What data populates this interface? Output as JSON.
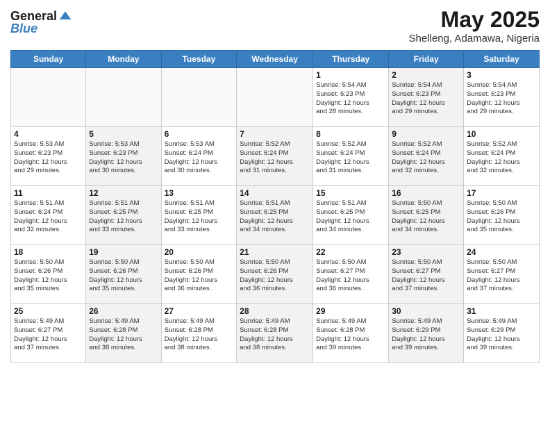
{
  "logo": {
    "line1": "General",
    "line2": "Blue"
  },
  "title": "May 2025",
  "subtitle": "Shelleng, Adamawa, Nigeria",
  "weekdays": [
    "Sunday",
    "Monday",
    "Tuesday",
    "Wednesday",
    "Thursday",
    "Friday",
    "Saturday"
  ],
  "weeks": [
    [
      {
        "day": "",
        "empty": true
      },
      {
        "day": "",
        "empty": true
      },
      {
        "day": "",
        "empty": true
      },
      {
        "day": "",
        "empty": true
      },
      {
        "day": "1",
        "gray": false,
        "lines": [
          "Sunrise: 5:54 AM",
          "Sunset: 6:23 PM",
          "Daylight: 12 hours",
          "and 28 minutes."
        ]
      },
      {
        "day": "2",
        "gray": true,
        "lines": [
          "Sunrise: 5:54 AM",
          "Sunset: 6:23 PM",
          "Daylight: 12 hours",
          "and 29 minutes."
        ]
      },
      {
        "day": "3",
        "gray": false,
        "lines": [
          "Sunrise: 5:54 AM",
          "Sunset: 6:23 PM",
          "Daylight: 12 hours",
          "and 29 minutes."
        ]
      }
    ],
    [
      {
        "day": "4",
        "gray": false,
        "lines": [
          "Sunrise: 5:53 AM",
          "Sunset: 6:23 PM",
          "Daylight: 12 hours",
          "and 29 minutes."
        ]
      },
      {
        "day": "5",
        "gray": true,
        "lines": [
          "Sunrise: 5:53 AM",
          "Sunset: 6:23 PM",
          "Daylight: 12 hours",
          "and 30 minutes."
        ]
      },
      {
        "day": "6",
        "gray": false,
        "lines": [
          "Sunrise: 5:53 AM",
          "Sunset: 6:24 PM",
          "Daylight: 12 hours",
          "and 30 minutes."
        ]
      },
      {
        "day": "7",
        "gray": true,
        "lines": [
          "Sunrise: 5:52 AM",
          "Sunset: 6:24 PM",
          "Daylight: 12 hours",
          "and 31 minutes."
        ]
      },
      {
        "day": "8",
        "gray": false,
        "lines": [
          "Sunrise: 5:52 AM",
          "Sunset: 6:24 PM",
          "Daylight: 12 hours",
          "and 31 minutes."
        ]
      },
      {
        "day": "9",
        "gray": true,
        "lines": [
          "Sunrise: 5:52 AM",
          "Sunset: 6:24 PM",
          "Daylight: 12 hours",
          "and 32 minutes."
        ]
      },
      {
        "day": "10",
        "gray": false,
        "lines": [
          "Sunrise: 5:52 AM",
          "Sunset: 6:24 PM",
          "Daylight: 12 hours",
          "and 32 minutes."
        ]
      }
    ],
    [
      {
        "day": "11",
        "gray": false,
        "lines": [
          "Sunrise: 5:51 AM",
          "Sunset: 6:24 PM",
          "Daylight: 12 hours",
          "and 32 minutes."
        ]
      },
      {
        "day": "12",
        "gray": true,
        "lines": [
          "Sunrise: 5:51 AM",
          "Sunset: 6:25 PM",
          "Daylight: 12 hours",
          "and 33 minutes."
        ]
      },
      {
        "day": "13",
        "gray": false,
        "lines": [
          "Sunrise: 5:51 AM",
          "Sunset: 6:25 PM",
          "Daylight: 12 hours",
          "and 33 minutes."
        ]
      },
      {
        "day": "14",
        "gray": true,
        "lines": [
          "Sunrise: 5:51 AM",
          "Sunset: 6:25 PM",
          "Daylight: 12 hours",
          "and 34 minutes."
        ]
      },
      {
        "day": "15",
        "gray": false,
        "lines": [
          "Sunrise: 5:51 AM",
          "Sunset: 6:25 PM",
          "Daylight: 12 hours",
          "and 34 minutes."
        ]
      },
      {
        "day": "16",
        "gray": true,
        "lines": [
          "Sunrise: 5:50 AM",
          "Sunset: 6:25 PM",
          "Daylight: 12 hours",
          "and 34 minutes."
        ]
      },
      {
        "day": "17",
        "gray": false,
        "lines": [
          "Sunrise: 5:50 AM",
          "Sunset: 6:26 PM",
          "Daylight: 12 hours",
          "and 35 minutes."
        ]
      }
    ],
    [
      {
        "day": "18",
        "gray": false,
        "lines": [
          "Sunrise: 5:50 AM",
          "Sunset: 6:26 PM",
          "Daylight: 12 hours",
          "and 35 minutes."
        ]
      },
      {
        "day": "19",
        "gray": true,
        "lines": [
          "Sunrise: 5:50 AM",
          "Sunset: 6:26 PM",
          "Daylight: 12 hours",
          "and 35 minutes."
        ]
      },
      {
        "day": "20",
        "gray": false,
        "lines": [
          "Sunrise: 5:50 AM",
          "Sunset: 6:26 PM",
          "Daylight: 12 hours",
          "and 36 minutes."
        ]
      },
      {
        "day": "21",
        "gray": true,
        "lines": [
          "Sunrise: 5:50 AM",
          "Sunset: 6:26 PM",
          "Daylight: 12 hours",
          "and 36 minutes."
        ]
      },
      {
        "day": "22",
        "gray": false,
        "lines": [
          "Sunrise: 5:50 AM",
          "Sunset: 6:27 PM",
          "Daylight: 12 hours",
          "and 36 minutes."
        ]
      },
      {
        "day": "23",
        "gray": true,
        "lines": [
          "Sunrise: 5:50 AM",
          "Sunset: 6:27 PM",
          "Daylight: 12 hours",
          "and 37 minutes."
        ]
      },
      {
        "day": "24",
        "gray": false,
        "lines": [
          "Sunrise: 5:50 AM",
          "Sunset: 6:27 PM",
          "Daylight: 12 hours",
          "and 37 minutes."
        ]
      }
    ],
    [
      {
        "day": "25",
        "gray": false,
        "lines": [
          "Sunrise: 5:49 AM",
          "Sunset: 6:27 PM",
          "Daylight: 12 hours",
          "and 37 minutes."
        ]
      },
      {
        "day": "26",
        "gray": true,
        "lines": [
          "Sunrise: 5:49 AM",
          "Sunset: 6:28 PM",
          "Daylight: 12 hours",
          "and 38 minutes."
        ]
      },
      {
        "day": "27",
        "gray": false,
        "lines": [
          "Sunrise: 5:49 AM",
          "Sunset: 6:28 PM",
          "Daylight: 12 hours",
          "and 38 minutes."
        ]
      },
      {
        "day": "28",
        "gray": true,
        "lines": [
          "Sunrise: 5:49 AM",
          "Sunset: 6:28 PM",
          "Daylight: 12 hours",
          "and 38 minutes."
        ]
      },
      {
        "day": "29",
        "gray": false,
        "lines": [
          "Sunrise: 5:49 AM",
          "Sunset: 6:28 PM",
          "Daylight: 12 hours",
          "and 39 minutes."
        ]
      },
      {
        "day": "30",
        "gray": true,
        "lines": [
          "Sunrise: 5:49 AM",
          "Sunset: 6:29 PM",
          "Daylight: 12 hours",
          "and 39 minutes."
        ]
      },
      {
        "day": "31",
        "gray": false,
        "lines": [
          "Sunrise: 5:49 AM",
          "Sunset: 6:29 PM",
          "Daylight: 12 hours",
          "and 39 minutes."
        ]
      }
    ]
  ]
}
